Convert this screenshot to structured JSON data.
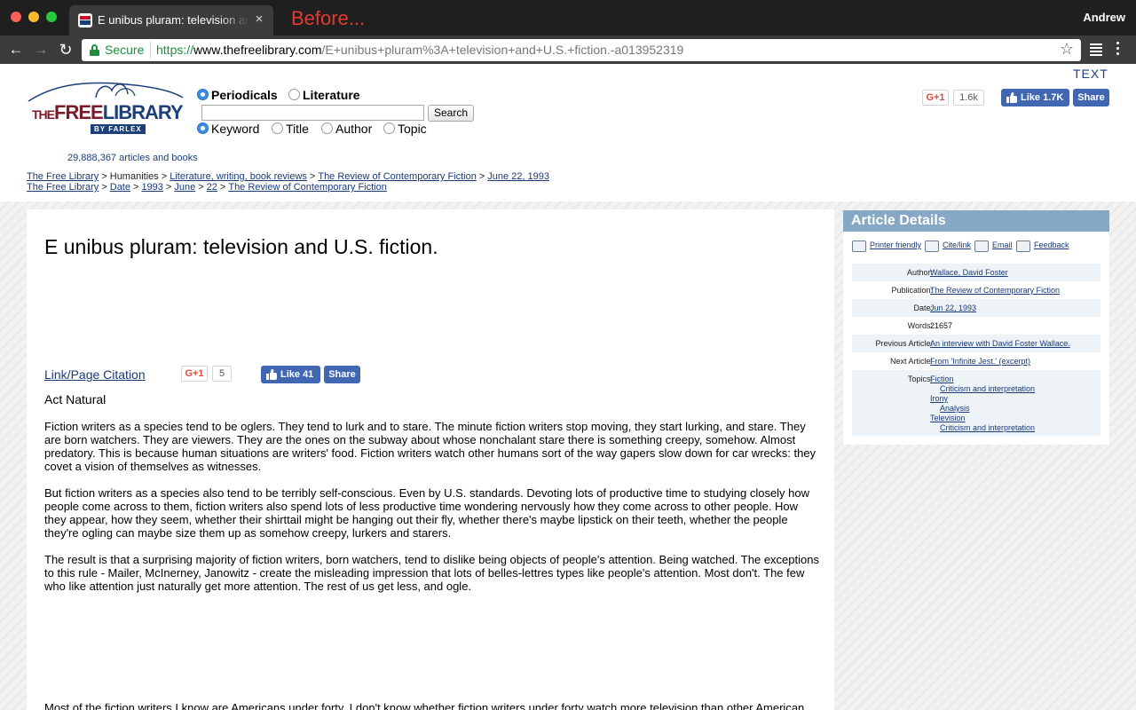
{
  "browser": {
    "tab_title": "E unibus pluram: television and U.S. fiction",
    "tab_close": "×",
    "annotation": "Before...",
    "profile_name": "Andrew",
    "secure_label": "Secure",
    "url_protocol": "https://",
    "url_host": "www.thefreelibrary.com",
    "url_path": "/E+unibus+pluram%3A+television+and+U.S.+fiction.-a013952319",
    "back_icon": "←",
    "forward_icon": "→",
    "reload_icon": "↻",
    "star_icon": "☆"
  },
  "header": {
    "logo_the": "THE",
    "logo_free": "FREE",
    "logo_library": "LIBRARY",
    "logo_byline": "BY FARLEX",
    "article_count": "29,888,367 articles and books",
    "scope_options": [
      "Periodicals",
      "Literature"
    ],
    "scope_selected": "Periodicals",
    "search_placeholder": "",
    "search_button": "Search",
    "field_options": [
      "Keyword",
      "Title",
      "Author",
      "Topic"
    ],
    "field_selected": "Keyword",
    "text_size_toggle": "TEXT",
    "gplus_label": "G+1",
    "gplus_count": "1.6k",
    "fb_like_label": "Like 1.7K",
    "fb_share_label": "Share"
  },
  "breadcrumbs": {
    "row1": [
      "The Free Library",
      "Humanities",
      "Literature, writing, book reviews",
      "The Review of Contemporary Fiction",
      "June 22, 1993"
    ],
    "row2": [
      "The Free Library",
      "Date",
      "1993",
      "June",
      "22",
      "The Review of Contemporary Fiction"
    ],
    "separator": ">"
  },
  "article": {
    "title": "E unibus pluram: television and U.S. fiction.",
    "citation_link": "Link/Page Citation",
    "gplus_label": "G+1",
    "gplus_count": "5",
    "fb_like_label": "Like 41",
    "fb_share_label": "Share",
    "section_heading": "Act Natural",
    "paragraphs": [
      "Fiction writers as a species tend to be oglers. They tend to lurk and to stare. The minute fiction writers stop moving, they start lurking, and stare. They are born watchers. They are viewers. They are the ones on the subway about whose nonchalant stare there is something creepy, somehow. Almost predatory. This is because human situations are writers' food. Fiction writers watch other humans sort of the way gapers slow down for car wrecks: they covet a vision of themselves as witnesses.",
      "But fiction writers as a species also tend to be terribly self-conscious. Even by U.S. standards. Devoting lots of productive time to studying closely how people come across to them, fiction writers also spend lots of less productive time wondering nervously how they come across to other people. How they appear, how they seem, whether their shirttail might be hanging out their fly, whether there's maybe lipstick on their teeth, whether the people they're ogling can maybe size them up as somehow creepy, lurkers and starers.",
      "The result is that a surprising majority of fiction writers, born watchers, tend to dislike being objects of people's attention. Being watched. The exceptions to this rule - Mailer, McInerney, Janowitz - create the misleading impression that lots of belles-lettres types like people's attention. Most don't. The few who like attention just naturally get more attention. The rest of us get less, and ogle.",
      "Most of the fiction writers I know are Americans under forty. I don't know whether fiction writers under forty watch more television than other American"
    ]
  },
  "details": {
    "heading": "Article Details",
    "tools": [
      "Printer friendly",
      "Cite/link",
      "Email",
      "Feedback"
    ],
    "author_label": "Author:",
    "author": "Wallace, David Foster",
    "publication_label": "Publication:",
    "publication": "The Review of Contemporary Fiction",
    "date_label": "Date:",
    "date": "Jun 22, 1993",
    "words_label": "Words:",
    "words": "21657",
    "previous_label": "Previous Article:",
    "previous": "An interview with David Foster Wallace.",
    "next_label": "Next Article:",
    "next": "From 'Infinite Jest.' (excerpt)",
    "topics_label": "Topics:",
    "topics": [
      "Fiction",
      "Criticism and interpretation",
      "Irony",
      "Analysis",
      "Television",
      "Criticism and interpretation"
    ]
  }
}
